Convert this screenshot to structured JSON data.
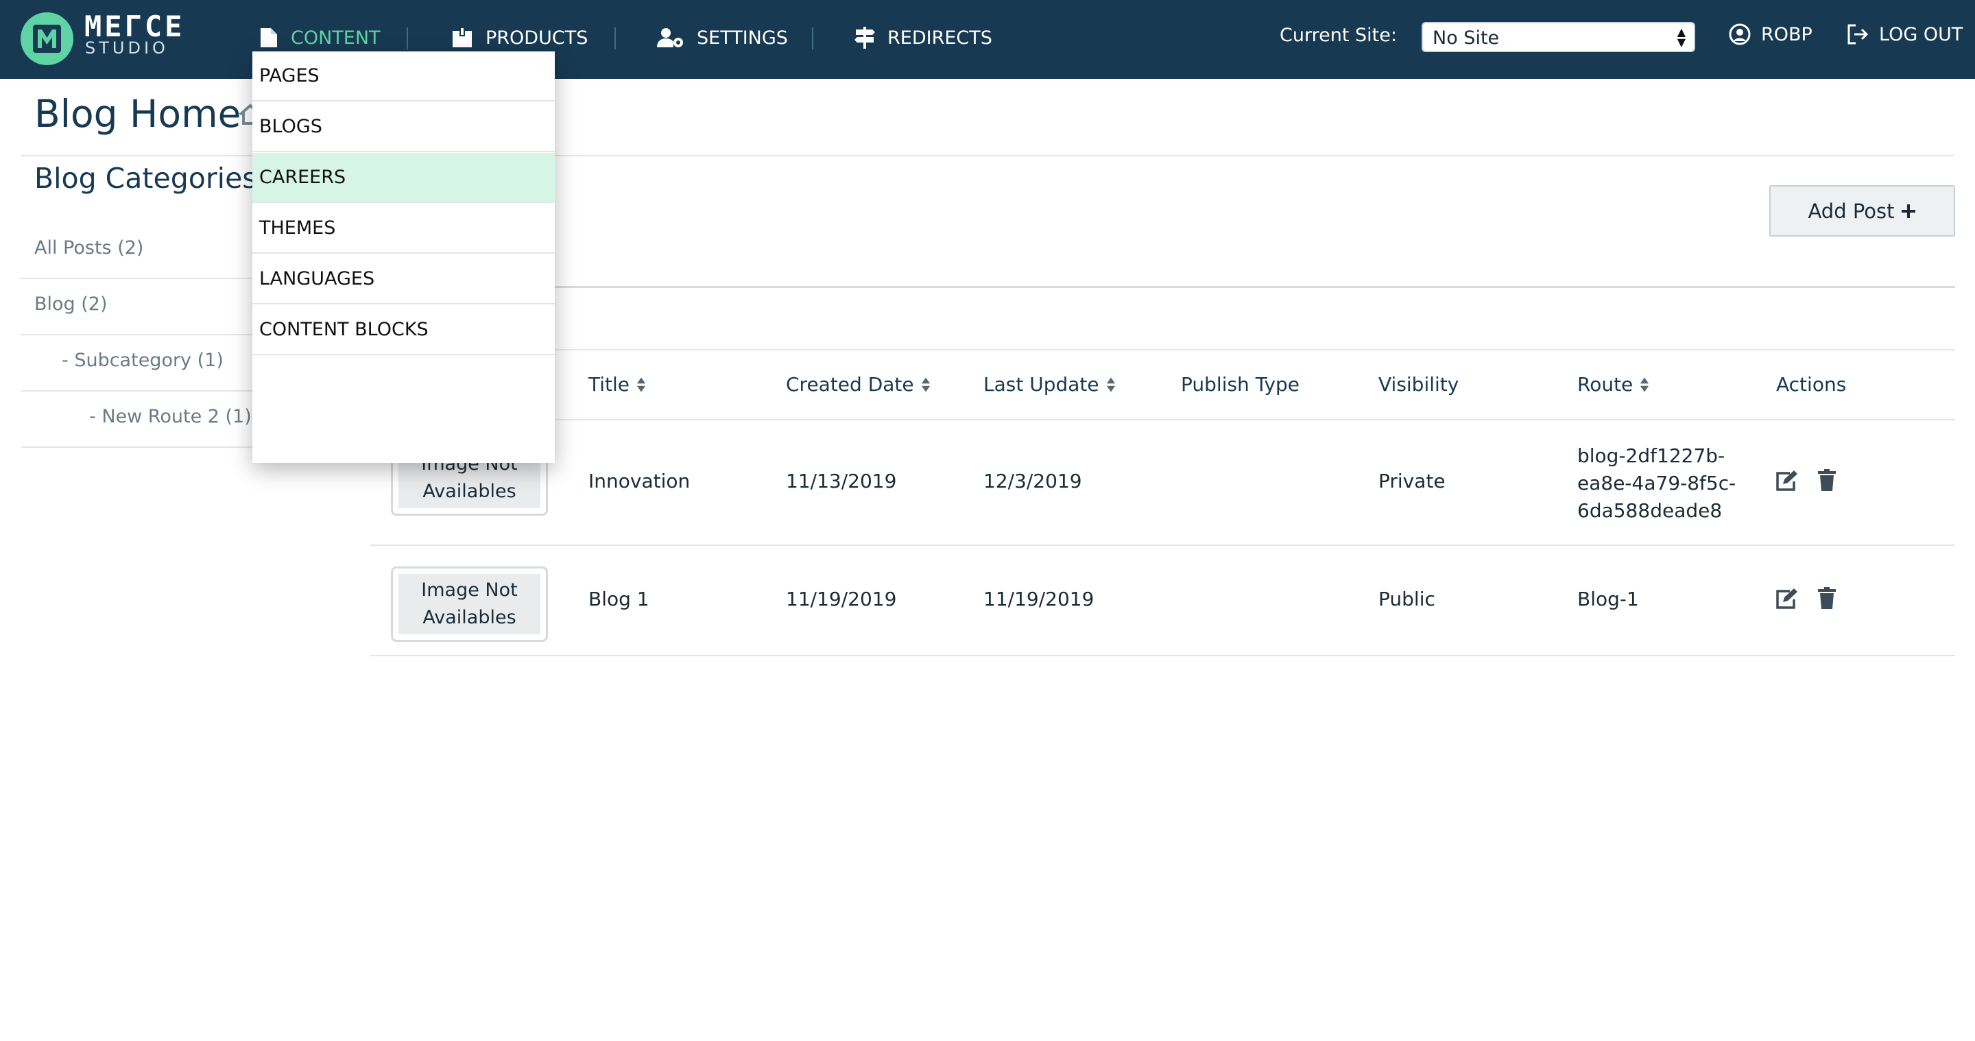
{
  "header": {
    "logo_word": "ΜΕΓCΕ",
    "logo_sub": "STUDIO",
    "nav": [
      {
        "label": "CONTENT",
        "icon": "file-icon",
        "active": true
      },
      {
        "label": "PRODUCTS",
        "icon": "box-icon",
        "active": false
      },
      {
        "label": "SETTINGS",
        "icon": "user-gear-icon",
        "active": false
      },
      {
        "label": "REDIRECTS",
        "icon": "signpost-icon",
        "active": false
      }
    ],
    "current_site_label": "Current Site:",
    "current_site_value": "No Site",
    "user_label": "ROBP",
    "logout_label": "LOG OUT"
  },
  "page": {
    "title": "Blog Home",
    "categories_heading": "Blog Categories:"
  },
  "categories": [
    {
      "label": "All Posts (2)"
    },
    {
      "label": "Blog (2)"
    },
    {
      "label": "- Subcategory (1)"
    },
    {
      "label": "- New Route 2 (1)"
    }
  ],
  "add_post_label": "Add Post",
  "table": {
    "headers": [
      "Title",
      "Created Date",
      "Last Update",
      "Publish Type",
      "Visibility",
      "Route",
      "Actions"
    ],
    "rows": [
      {
        "image_text": "Image Not Availables",
        "title": "Innovation",
        "created": "11/13/2019",
        "updated": "12/3/2019",
        "publish_type": "",
        "visibility": "Private",
        "route_lines": [
          "blog-2df1227b-",
          "ea8e-4a79-8f5c-",
          "6da588deade8"
        ]
      },
      {
        "image_text": "Image Not Availables",
        "title": "Blog 1",
        "created": "11/19/2019",
        "updated": "11/19/2019",
        "publish_type": "",
        "visibility": "Public",
        "route_lines": [
          "Blog-1"
        ]
      }
    ]
  },
  "content_menu": {
    "items": [
      "PAGES",
      "BLOGS",
      "CAREERS",
      "THEMES",
      "LANGUAGES",
      "CONTENT BLOCKS"
    ],
    "hovered": "CAREERS"
  },
  "colors": {
    "header_bg": "#173a52",
    "accent": "#5fd3a4",
    "hover_bg": "#d7f5e7"
  }
}
